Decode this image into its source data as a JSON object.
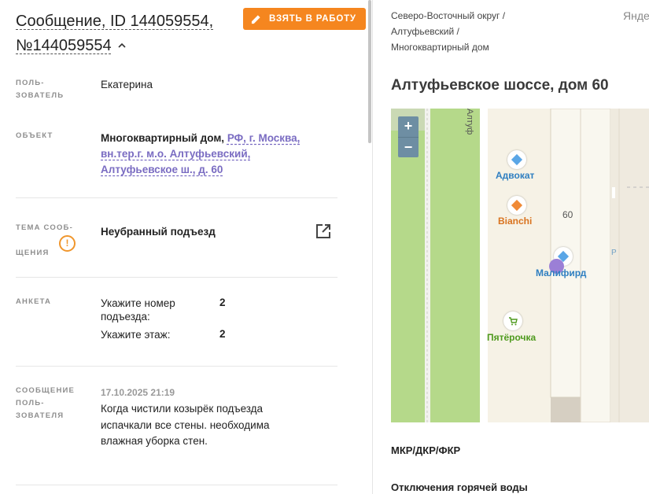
{
  "header": {
    "title": "Сообщение, ID 144059554, №144059554",
    "take_button": "ВЗЯТЬ В РАБОТУ"
  },
  "fields": {
    "user_label": "ПОЛЬ-ЗОВАТЕЛЬ",
    "user_value": "Екатерина",
    "object_label": "ОБЪЕКТ",
    "object_type": "Многоквартирный дом,",
    "object_address": "РФ, г. Москва, вн.тер.г. м.о. Алтуфьевский, Алтуфьевское ш., д. 60",
    "topic_label": "ТЕМА СООБ-ЩЕНИЯ",
    "topic_value": "Неубранный подъезд",
    "survey_label": "АНКЕТА",
    "survey": [
      {
        "q": "Укажите номер подъезда:",
        "a": "2"
      },
      {
        "q": "Укажите этаж:",
        "a": "2"
      }
    ],
    "message_label": "СООБЩЕНИЕ ПОЛЬ-ЗОВАТЕЛЯ",
    "message_date": "17.10.2025 21:19",
    "message_text": "Когда чистили козырёк подъезда испачкали все стены. необходима влажная уборка стен."
  },
  "right": {
    "breadcrumbs": [
      "Северо-Восточный округ /",
      "Алтуфьевский /",
      "Многоквартирный дом"
    ],
    "place_title": "Алтуфьевское шоссе, дом 60",
    "yandex_partial": "Янде",
    "section_1": "МКР/ДКР/ФКР",
    "section_2": "Отключения горячей воды"
  },
  "map": {
    "zoom_in": "+",
    "zoom_out": "−",
    "road_label": "Алтуф",
    "house_number": "60",
    "parking_label": "P",
    "pois": [
      {
        "name": "Адвокат",
        "color": "#2f7fc1"
      },
      {
        "name": "Bianchi",
        "color": "#d9731f"
      },
      {
        "name": "Малифирд",
        "color": "#2f7fc1"
      },
      {
        "name": "Пятёрочка",
        "color": "#4f9a1e"
      }
    ]
  },
  "colors": {
    "accent": "#f5861f",
    "link": "#7a6cc2",
    "warning": "#f0962c"
  }
}
